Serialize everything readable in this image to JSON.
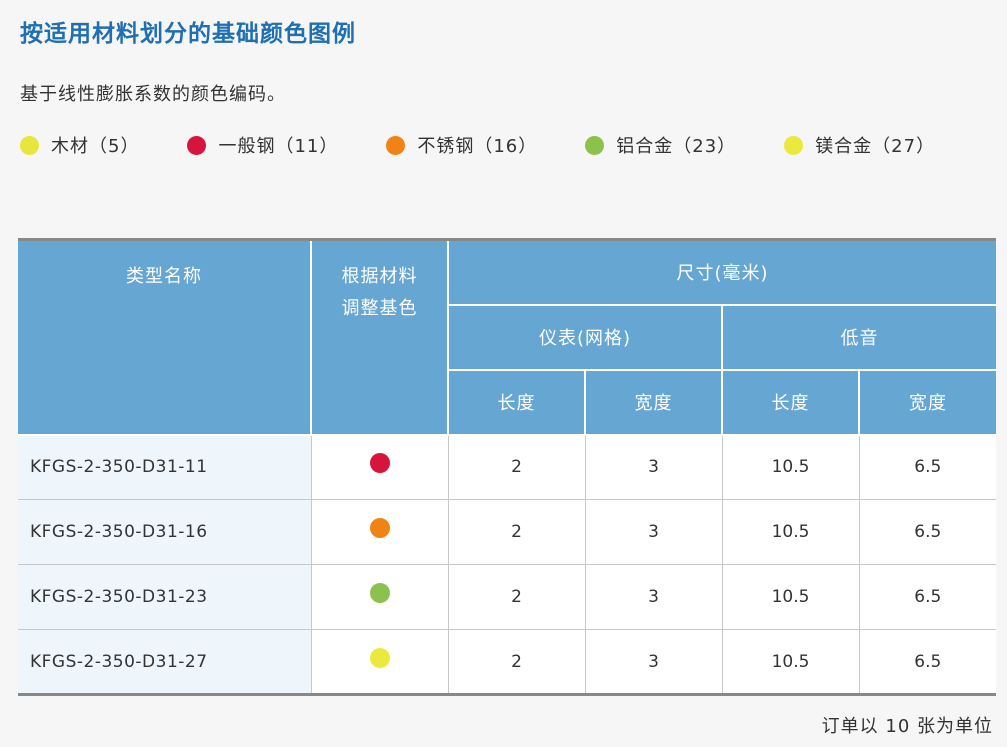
{
  "title": "按适用材料划分的基础颜色图例",
  "subtitle": "基于线性膨胀系数的颜色编码。",
  "legend": [
    {
      "label": "木材（5）",
      "color": "#e8e53c"
    },
    {
      "label": "一般钢（11）",
      "color": "#d7143b"
    },
    {
      "label": "不锈钢（16）",
      "color": "#f08314"
    },
    {
      "label": "铝合金（23）",
      "color": "#8cc14e"
    },
    {
      "label": "镁合金（27）",
      "color": "#ece93e"
    }
  ],
  "table": {
    "headers": {
      "type_name": "类型名称",
      "base_color_line1": "根据材料",
      "base_color_line2": "调整基色",
      "size": "尺寸(毫米)",
      "meter": "仪表(网格)",
      "bass": "低音",
      "length1": "长度",
      "width1": "宽度",
      "length2": "长度",
      "width2": "宽度"
    },
    "rows": [
      {
        "name": "KFGS-2-350-D31-11",
        "color": "#d7143b",
        "meter_length": "2",
        "meter_width": "3",
        "bass_length": "10.5",
        "bass_width": "6.5"
      },
      {
        "name": "KFGS-2-350-D31-16",
        "color": "#f08314",
        "meter_length": "2",
        "meter_width": "3",
        "bass_length": "10.5",
        "bass_width": "6.5"
      },
      {
        "name": "KFGS-2-350-D31-23",
        "color": "#8cc14e",
        "meter_length": "2",
        "meter_width": "3",
        "bass_length": "10.5",
        "bass_width": "6.5"
      },
      {
        "name": "KFGS-2-350-D31-27",
        "color": "#ece93e",
        "meter_length": "2",
        "meter_width": "3",
        "bass_length": "10.5",
        "bass_width": "6.5"
      }
    ]
  },
  "note": "订单以 10 张为单位"
}
